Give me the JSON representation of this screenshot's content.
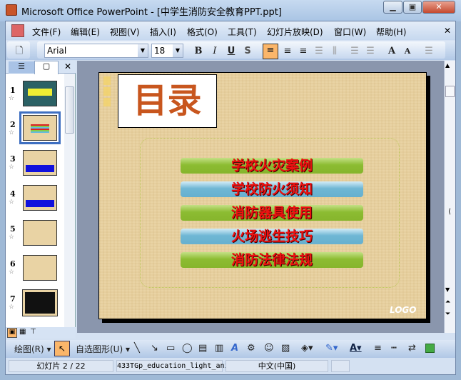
{
  "window": {
    "title": "Microsoft Office PowerPoint - [中学生消防安全教育PPT.ppt]"
  },
  "menu": [
    "文件(F)",
    "编辑(E)",
    "视图(V)",
    "插入(I)",
    "格式(O)",
    "工具(T)",
    "幻灯片放映(D)",
    "窗口(W)",
    "帮助(H)"
  ],
  "toolbar": {
    "font": "Arial",
    "size": "18"
  },
  "thumbnails": [
    {
      "num": "1"
    },
    {
      "num": "2"
    },
    {
      "num": "3"
    },
    {
      "num": "4"
    },
    {
      "num": "5"
    },
    {
      "num": "6"
    },
    {
      "num": "7"
    }
  ],
  "slide": {
    "title": "目录",
    "items": [
      "学校火灾案例",
      "学校防火须知",
      "消防器具使用",
      "火场逃生技巧",
      "消防法律法规"
    ],
    "logo": "LOGO"
  },
  "drawing": {
    "draw_label": "绘图(R)",
    "autoshapes_label": "自选图形(U)"
  },
  "status": {
    "slide": "幻灯片 2 / 22",
    "design": "433TGp_education_light_ani",
    "language": "中文(中国)"
  }
}
